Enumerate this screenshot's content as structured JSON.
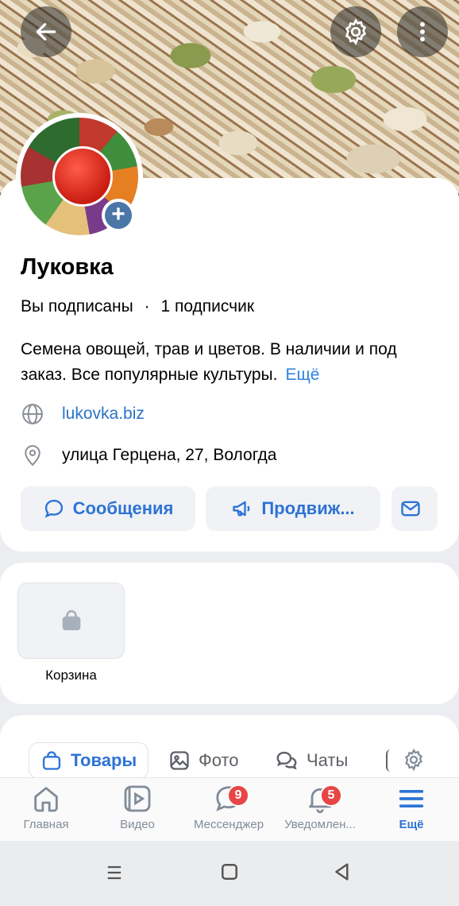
{
  "header": {
    "back_icon": "arrow-left-icon",
    "settings_icon": "gear-icon",
    "menu_icon": "more-vertical-icon"
  },
  "profile": {
    "name": "Луковка",
    "subscribed": "Вы подписаны",
    "separator": "·",
    "followers": "1 подписчик",
    "description": "Семена овощей, трав и цветов. В наличии и под заказ. Все популярные культуры.",
    "more_link": "Ещё",
    "website": "lukovka.biz",
    "address": "улица Герцена, 27, Вологда",
    "add_avatar": "+"
  },
  "actions": {
    "messages": "Сообщения",
    "promote": "Продвиж..."
  },
  "shop": {
    "cart_label": "Корзина"
  },
  "tabs": [
    {
      "label": "Товары"
    },
    {
      "label": "Фото"
    },
    {
      "label": "Чаты"
    }
  ],
  "bottom_nav": [
    {
      "label": "Главная",
      "icon": "home-icon"
    },
    {
      "label": "Видео",
      "icon": "video-icon"
    },
    {
      "label": "Мессенджер",
      "icon": "messenger-icon",
      "badge": "9"
    },
    {
      "label": "Уведомлен...",
      "icon": "bell-icon",
      "badge": "5"
    },
    {
      "label": "Ещё",
      "icon": "menu-icon"
    }
  ],
  "colors": {
    "accent": "#2d73d6",
    "badge": "#e64646",
    "link": "#2a72c7"
  }
}
